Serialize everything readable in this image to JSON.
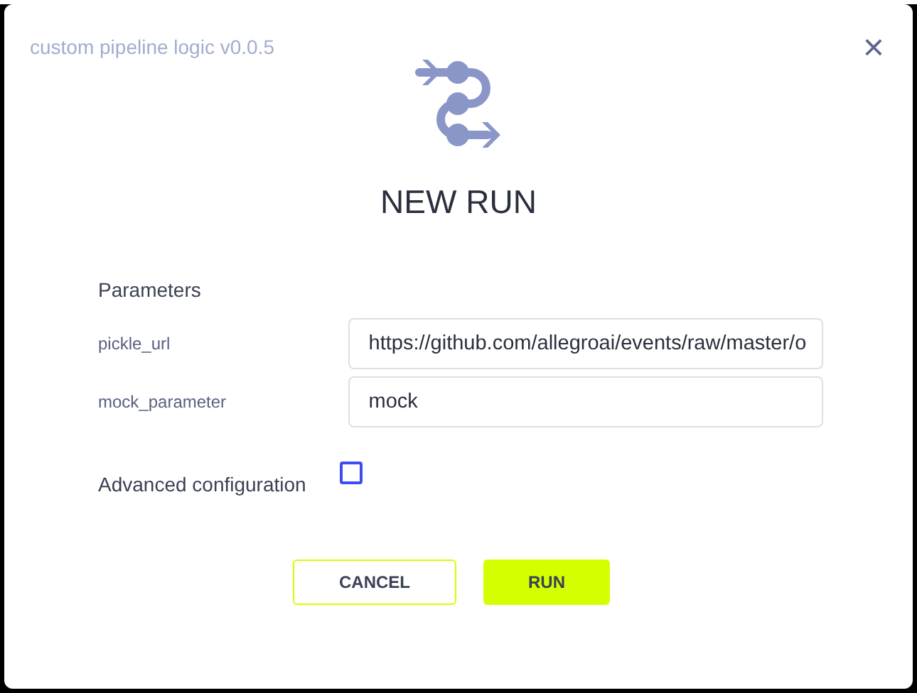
{
  "dialog": {
    "subtitle": "custom pipeline logic v0.0.5",
    "close": "×",
    "title": "NEW RUN"
  },
  "parameters": {
    "heading": "Parameters",
    "fields": [
      {
        "label": "pickle_url",
        "value": "https://github.com/allegroai/events/raw/master/o"
      },
      {
        "label": "mock_parameter",
        "value": "mock"
      }
    ]
  },
  "advanced": {
    "label": "Advanced configuration",
    "checked": false
  },
  "buttons": [
    {
      "label": "CANCEL",
      "kind": "secondary"
    },
    {
      "label": "RUN",
      "kind": "primary"
    }
  ]
}
